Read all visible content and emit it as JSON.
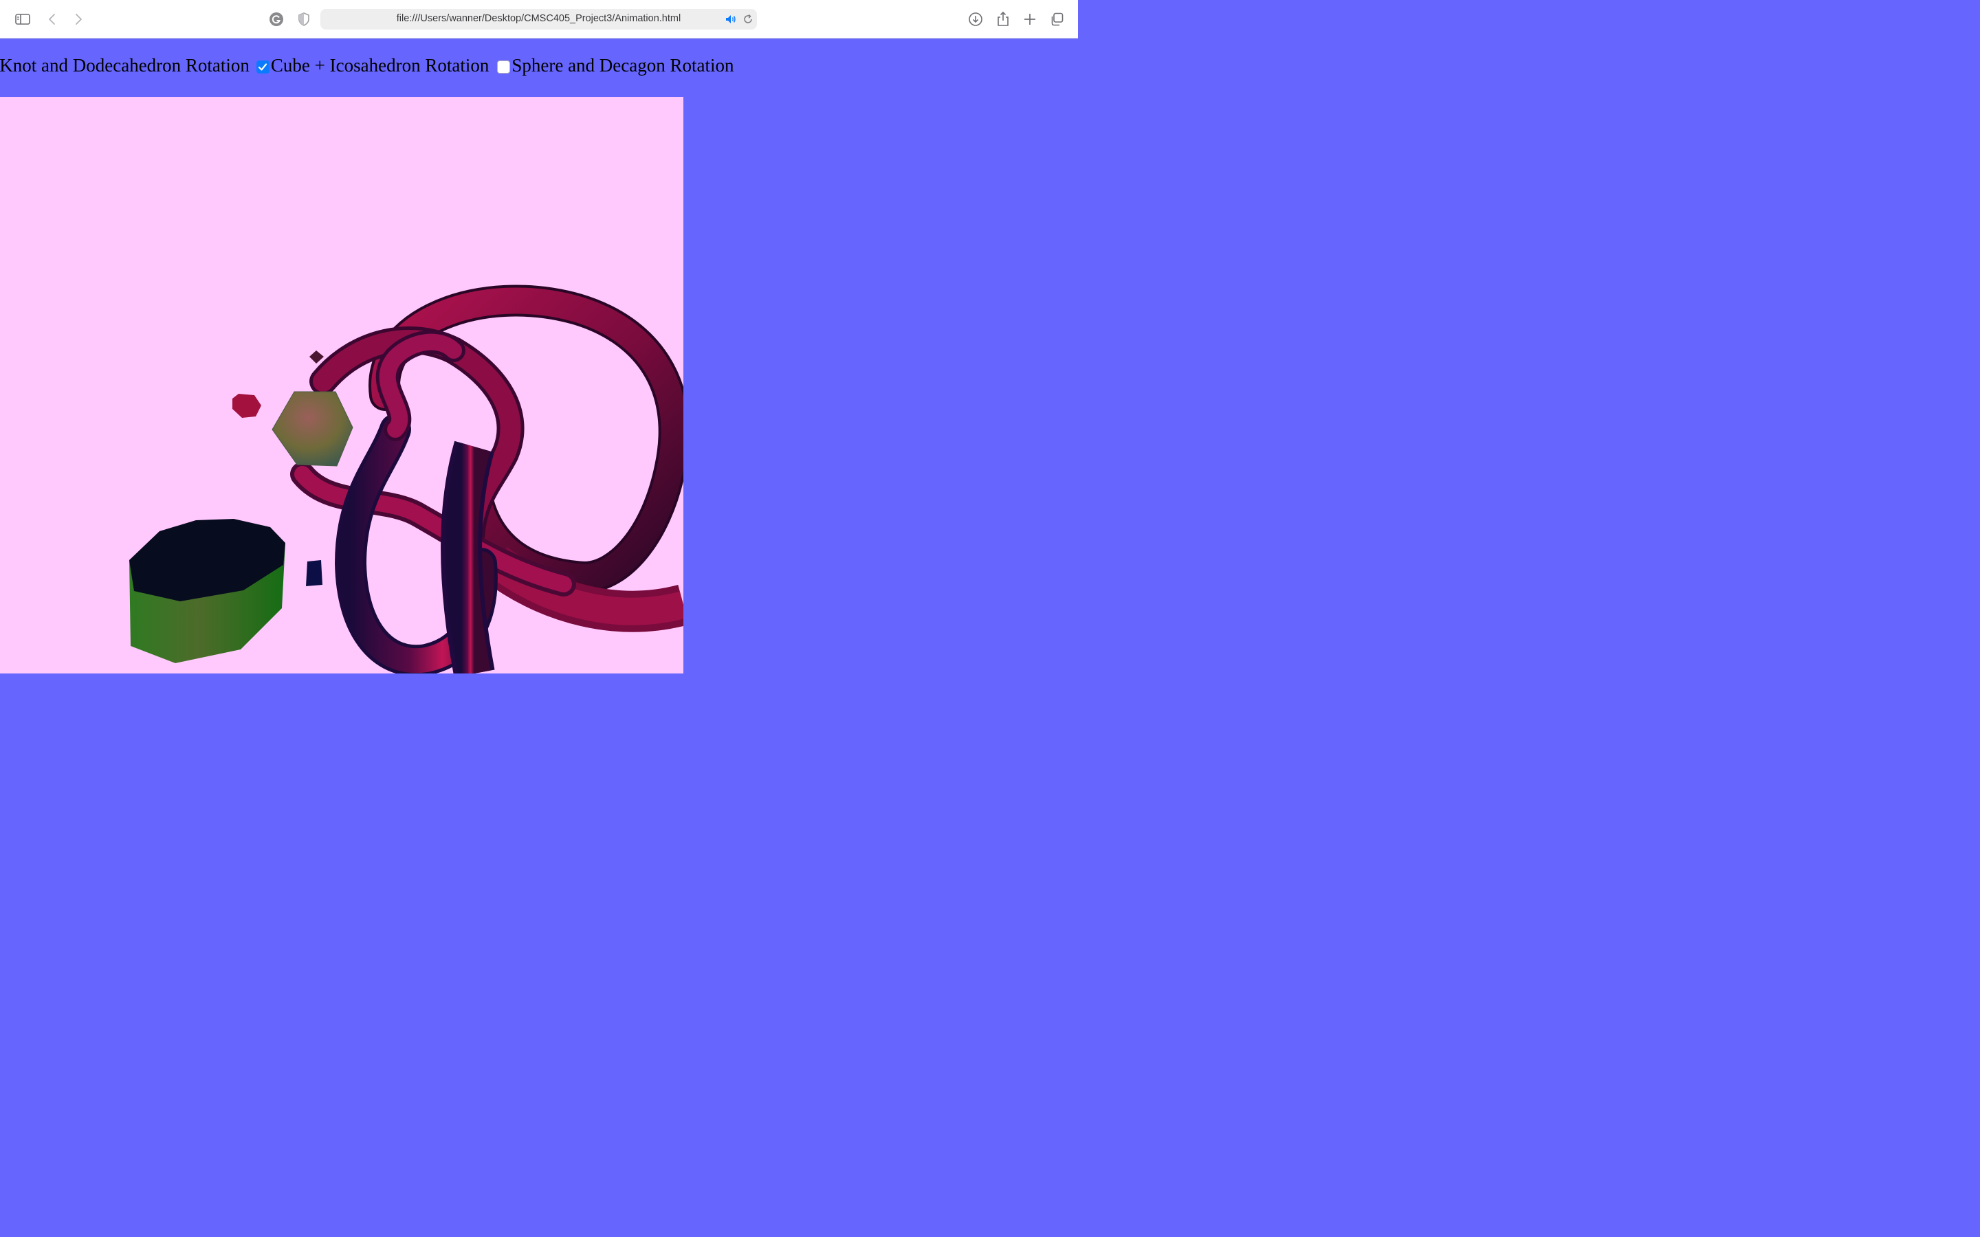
{
  "browser": {
    "url": "file:///Users/wanner/Desktop/CMSC405_Project3/Animation.html",
    "icons": {
      "sidebar": "sidebar-icon",
      "back": "chevron-left-icon",
      "forward": "chevron-right-icon",
      "extension": "grammarly-icon",
      "privacy": "shield-icon",
      "audio": "speaker-icon",
      "reload": "reload-icon",
      "downloads": "download-icon",
      "share": "share-icon",
      "new_tab": "plus-icon",
      "tabs": "tab-overview-icon"
    }
  },
  "controls": {
    "options": [
      {
        "label": "Torus Knot and Dodecahedron Rotation",
        "visible_label": "s Knot and Dodecahedron Rotation",
        "checked": null
      },
      {
        "label": "Cube + Icosahedron Rotation",
        "checked": true
      },
      {
        "label": "Sphere and Decagon Rotation",
        "checked": false
      }
    ]
  },
  "scene": {
    "background_color": "#ffc9fd",
    "page_background": "#6666ff",
    "objects": [
      "torus-knot",
      "icosahedron",
      "small-cube",
      "small-dodecahedron",
      "tiny-diamond",
      "octagonal-prism"
    ]
  }
}
